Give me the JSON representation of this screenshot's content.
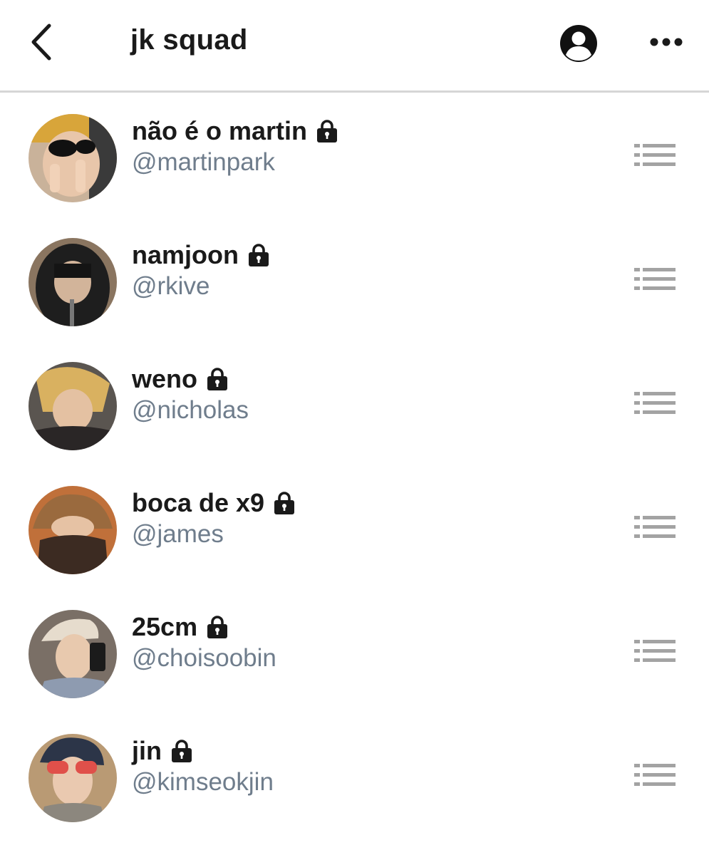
{
  "header": {
    "title": "jk squad",
    "back_icon": "chevron-left-icon",
    "profile_icon": "user-circle-icon",
    "more_icon": "more-horizontal-icon"
  },
  "colors": {
    "text": "#1a1a1a",
    "handle": "#6f7d8c",
    "list_icon": "#a3a3a3",
    "divider": "#d6d6d6"
  },
  "members": [
    {
      "name": "não é o martin",
      "handle": "@martinpark",
      "locked": true
    },
    {
      "name": "namjoon",
      "handle": "@rkive",
      "locked": true
    },
    {
      "name": "weno",
      "handle": "@nicholas",
      "locked": true
    },
    {
      "name": "boca de x9",
      "handle": "@james",
      "locked": true
    },
    {
      "name": "25cm",
      "handle": "@choisoobin",
      "locked": true
    },
    {
      "name": "jin",
      "handle": "@kimseokjin",
      "locked": true
    }
  ]
}
